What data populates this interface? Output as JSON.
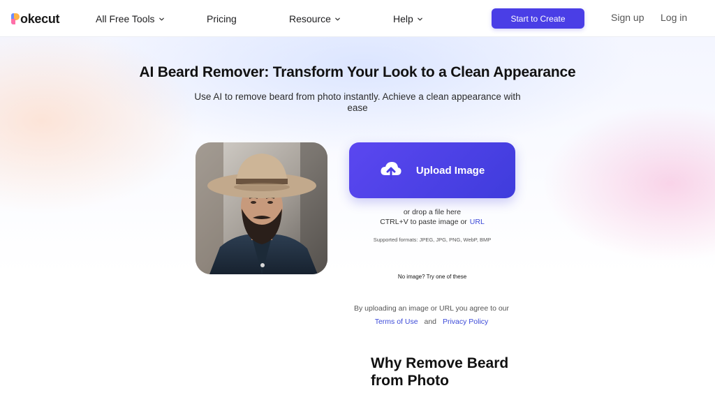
{
  "header": {
    "logo_text": "okecut",
    "nav": [
      {
        "label": "All Free Tools",
        "has_dropdown": true
      },
      {
        "label": "Pricing",
        "has_dropdown": false
      },
      {
        "label": "Resource",
        "has_dropdown": true
      },
      {
        "label": "Help",
        "has_dropdown": true
      }
    ],
    "cta_label": "Start to Create",
    "signup_label": "Sign up",
    "login_label": "Log in"
  },
  "hero": {
    "title": "AI Beard Remover: Transform Your Look to a Clean Appearance",
    "subtitle": "Use AI to remove beard from photo instantly. Achieve a clean appearance with ease"
  },
  "upload": {
    "button_label": "Upload Image",
    "drop_text": "or drop a file here",
    "paste_text": "CTRL+V to paste image or",
    "url_label": "URL",
    "formats": "Supported formats: JPEG, JPG, PNG, WebP, BMP",
    "try_text": "No image? Try one of these"
  },
  "terms": {
    "prefix": "By uploading an image or URL you agree to our",
    "terms_label": "Terms of Use",
    "and": "and",
    "privacy_label": "Privacy Policy"
  },
  "section": {
    "heading": "Why Remove Beard from Photo"
  },
  "colors": {
    "brand": "#4a3ee6",
    "link": "#3b49d8"
  },
  "icons": {
    "upload": "cloud-upload-icon",
    "dropdown": "chevron-down-icon"
  }
}
